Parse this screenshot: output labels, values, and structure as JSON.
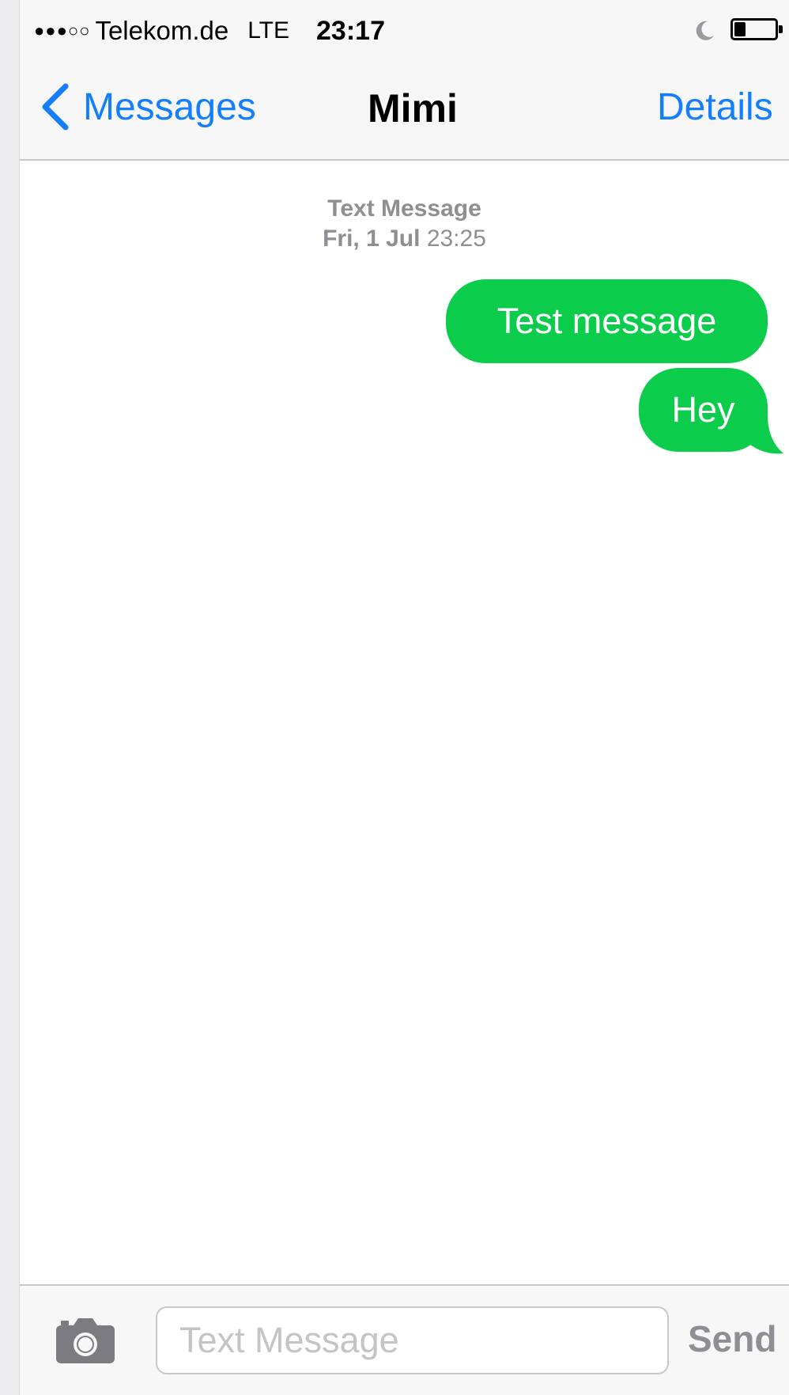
{
  "status_bar": {
    "signal": "●●●○○",
    "carrier": "Telekom.de",
    "network": "LTE",
    "time": "23:17",
    "icons": [
      "moon-icon",
      "battery-icon"
    ]
  },
  "nav": {
    "back_label": "Messages",
    "title": "Mimi",
    "details_label": "Details"
  },
  "thread": {
    "service": "Text Message",
    "date": "Fri, 1 Jul",
    "time": "23:25",
    "messages": [
      {
        "text": "Test message",
        "direction": "outgoing"
      },
      {
        "text": "Hey",
        "direction": "outgoing"
      }
    ]
  },
  "input": {
    "placeholder": "Text Message",
    "send_label": "Send",
    "camera_icon": "camera-icon"
  },
  "colors": {
    "accent": "#147efb",
    "bubble": "#0ccd4b",
    "muted": "#8e8e93"
  }
}
